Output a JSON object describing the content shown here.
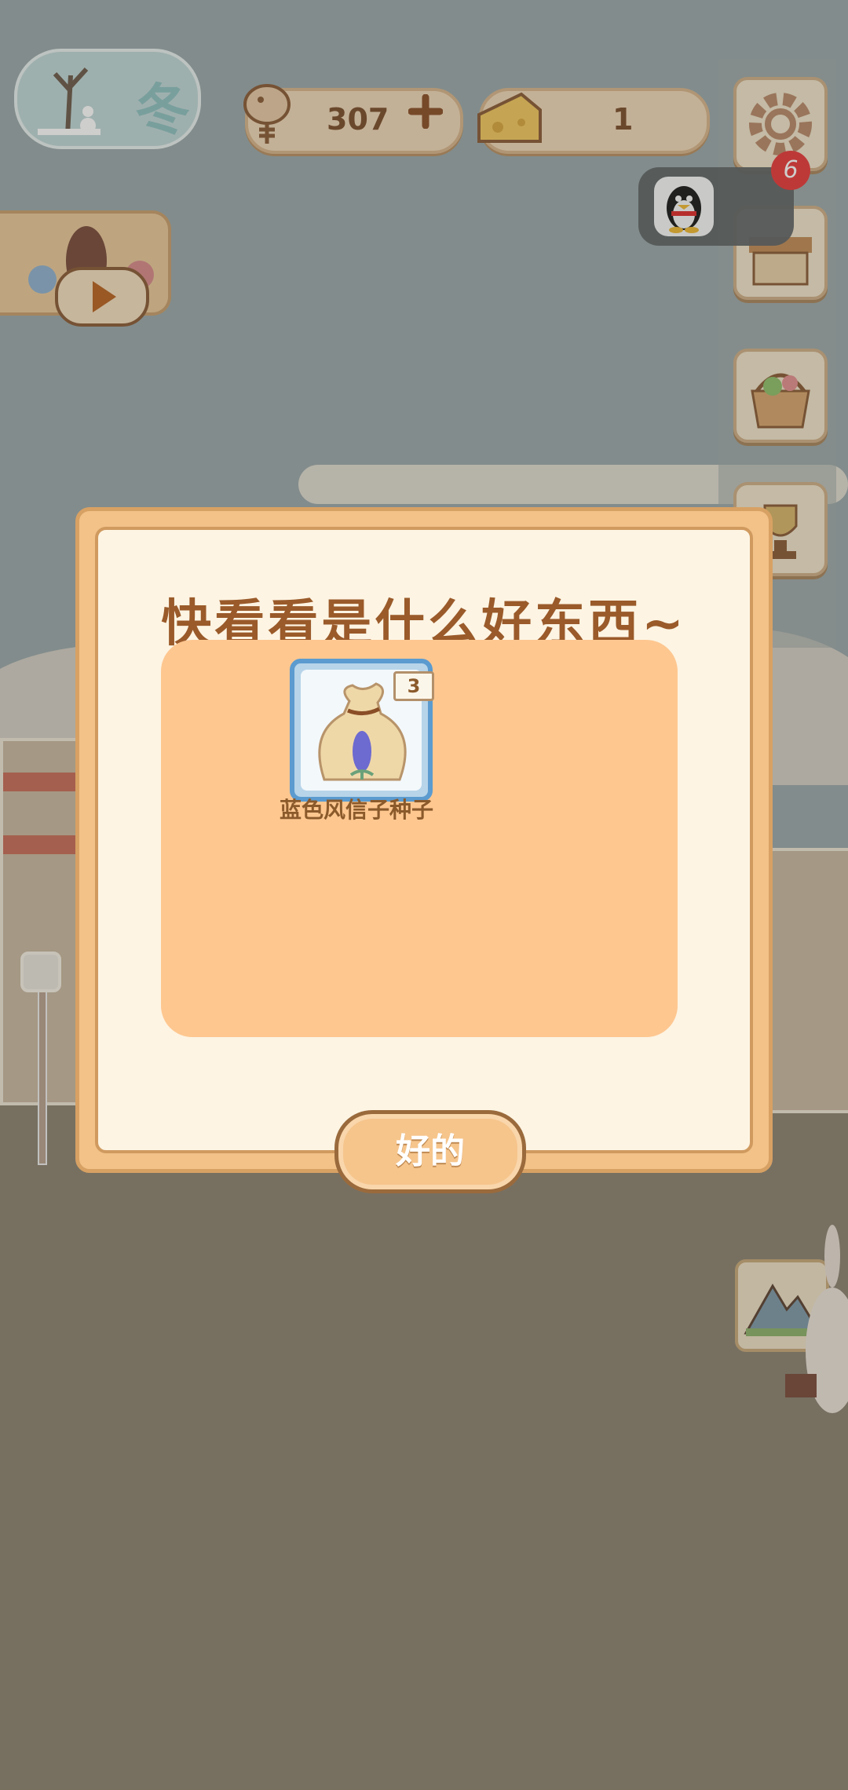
{
  "hud": {
    "season": "冬",
    "fish_count": "307",
    "cheese_count": "1",
    "notification_count": "6"
  },
  "dialog": {
    "title": "快看看是什么好东西~",
    "item": {
      "name": "蓝色风信子种子",
      "quantity": "3",
      "icon": "seed-bag-hyacinth-icon"
    },
    "confirm_label": "好的"
  },
  "side_menu": [
    "settings-icon",
    "shop-stall-icon",
    "basket-icon",
    "trophy-icon"
  ],
  "colors": {
    "dialog_bg": "#fdf4e3",
    "panel": "#fec790",
    "title": "#9a5a2a",
    "badge_red": "#e8393a",
    "item_frame": "#5b9bcf"
  }
}
